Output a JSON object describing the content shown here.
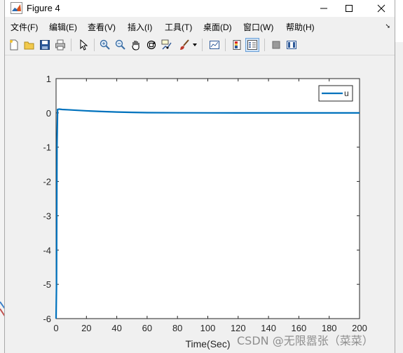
{
  "window": {
    "title": "Figure 4",
    "minimize_label": "—",
    "maximize_label": "☐",
    "close_label": "✕"
  },
  "menubar": {
    "items": [
      {
        "label": "文件(F)"
      },
      {
        "label": "编辑(E)"
      },
      {
        "label": "查看(V)"
      },
      {
        "label": "插入(I)"
      },
      {
        "label": "工具(T)"
      },
      {
        "label": "桌面(D)"
      },
      {
        "label": "窗口(W)"
      },
      {
        "label": "帮助(H)"
      }
    ],
    "overflow_icon": "dock-arrow-icon"
  },
  "toolbar": {
    "items": [
      {
        "name": "new-figure-button",
        "icon": "new-file-icon"
      },
      {
        "name": "open-file-button",
        "icon": "folder-open-icon"
      },
      {
        "name": "save-button",
        "icon": "save-icon"
      },
      {
        "name": "print-button",
        "icon": "print-icon"
      },
      {
        "name": "edit-plot-button",
        "icon": "pointer-arrow-icon"
      },
      {
        "name": "zoom-in-button",
        "icon": "zoom-in-icon"
      },
      {
        "name": "zoom-out-button",
        "icon": "zoom-out-icon"
      },
      {
        "name": "pan-button",
        "icon": "hand-icon"
      },
      {
        "name": "rotate-3d-button",
        "icon": "rotate-icon"
      },
      {
        "name": "data-cursor-button",
        "icon": "data-cursor-icon"
      },
      {
        "name": "brush-button",
        "icon": "brush-icon"
      },
      {
        "name": "link-plot-button",
        "icon": "link-plot-icon"
      },
      {
        "name": "insert-colorbar-button",
        "icon": "colorbar-icon"
      },
      {
        "name": "insert-legend-button",
        "icon": "legend-icon",
        "active": true
      },
      {
        "name": "hide-plot-tools-button",
        "icon": "hide-tools-icon"
      },
      {
        "name": "show-plot-tools-button",
        "icon": "show-tools-icon"
      }
    ]
  },
  "watermark": "CSDN @无限嚣张（菜菜）",
  "chart_data": {
    "type": "line",
    "title": "",
    "xlabel": "Time(Sec)",
    "ylabel": "",
    "xlim": [
      0,
      200
    ],
    "ylim": [
      -6,
      1
    ],
    "xticks": [
      0,
      20,
      40,
      60,
      80,
      100,
      120,
      140,
      160,
      180,
      200
    ],
    "yticks": [
      1,
      0,
      -1,
      -2,
      -3,
      -4,
      -5,
      -6
    ],
    "grid": false,
    "legend": {
      "position": "top-right",
      "entries": [
        "u"
      ]
    },
    "series": [
      {
        "name": "u",
        "color": "#0072bd",
        "x": [
          0,
          0.3,
          0.6,
          1,
          2,
          4,
          8,
          12,
          16,
          20,
          30,
          40,
          50,
          60,
          80,
          100,
          120,
          140,
          160,
          180,
          200
        ],
        "y": [
          -6,
          -5,
          -1,
          0.1,
          0.11,
          0.1,
          0.09,
          0.08,
          0.07,
          0.06,
          0.04,
          0.025,
          0.015,
          0.008,
          0.003,
          0.001,
          0,
          0,
          0,
          0,
          0
        ]
      }
    ]
  }
}
